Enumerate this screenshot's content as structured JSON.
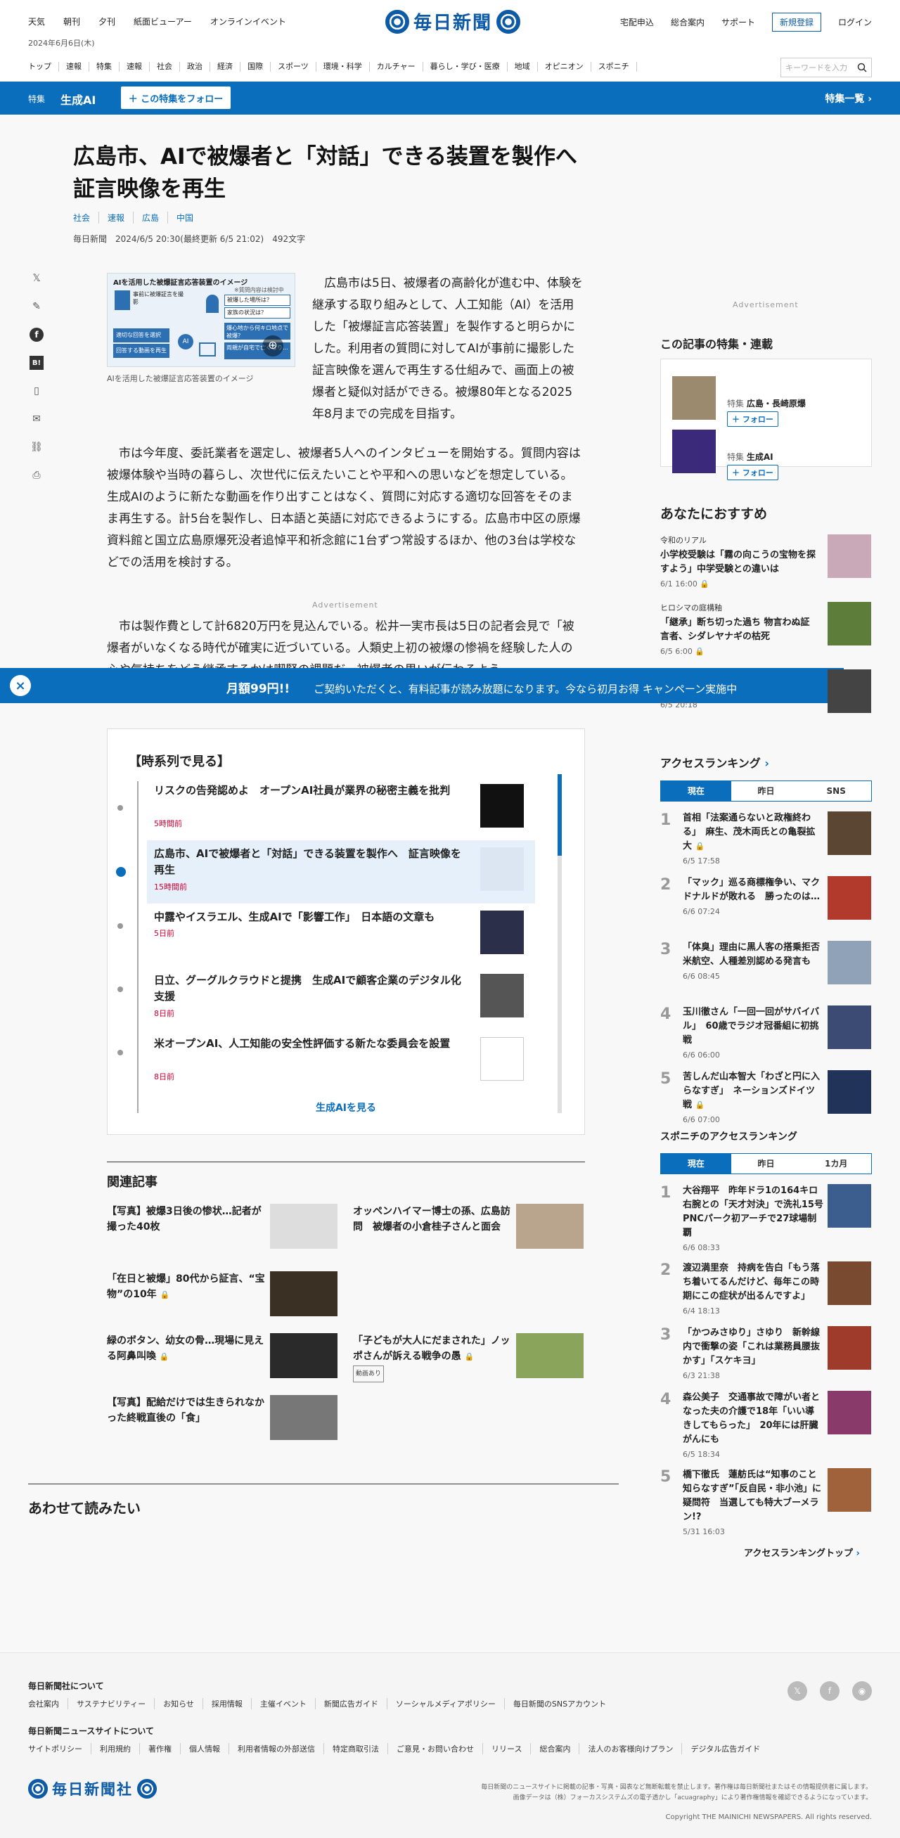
{
  "header": {
    "top_links": [
      "天気",
      "朝刊",
      "夕刊",
      "紙面ビューアー",
      "オンラインイベント"
    ],
    "date": "2024年6月6日(木)",
    "logo": "毎日新聞",
    "right_links": [
      "宅配申込",
      "総合案内",
      "サポート"
    ],
    "register": "新規登録",
    "login": "ログイン",
    "nav": [
      "トップ",
      "速報",
      "特集",
      "速報",
      "社会",
      "政治",
      "経済",
      "国際",
      "スポーツ",
      "環境・科学",
      "カルチャー",
      "暮らし・学び・医療",
      "地域",
      "オピニオン",
      "スポニチ"
    ],
    "search_placeholder": "キーワードを入力"
  },
  "feature_bar": {
    "tag": "特集",
    "title": "生成AI",
    "follow": "＋ この特集をフォロー",
    "list": "特集一覧"
  },
  "article": {
    "title": "広島市、AIで被爆者と「対話」できる装置を製作へ　証言映像を再生",
    "tags": [
      "社会",
      "速報",
      "広島",
      "中国"
    ],
    "source": "毎日新聞",
    "date": "2024/6/5 20:30(最終更新 6/5 21:02)",
    "chars": "492文字",
    "figure_title": "AIを活用した被爆証言応答装置のイメージ",
    "figure_note": "※質問内容は検討中",
    "figure_labels": [
      "事前に被爆証言を撮影",
      "被爆した場所は？",
      "家族の状況は？",
      "適切な回答を選択",
      "回答する動画を再生",
      "爆心地から何キロ地点で被爆？",
      "両親が自宅で亡くなり…"
    ],
    "figure_caption": "AIを活用した被爆証言応答装置のイメージ",
    "lead": "広島市は5日、被爆者の高齢化が進む中、体験を継承する取り組みとして、人工知能（AI）を活用した「被爆証言応答装置」を製作すると明らかにした。利用者の質問に対してAIが事前に撮影した証言映像を選んで再生する仕組みで、画面上の被爆者と疑似対話ができる。被爆80年となる2025年8月までの完成を目指す。",
    "para2": "市は今年度、委託業者を選定し、被爆者5人へのインタビューを開始する。質問内容は被爆体験や当時の暮らし、次世代に伝えたいことや平和への思いなどを想定している。生成AIのように新たな動画を作り出すことはなく、質問に対応する適切な回答をそのまま再生する。計5台を製作し、日本語と英語に対応できるようにする。広島市中区の原爆資料館と国立広島原爆死没者追悼平和祈念館に1台ずつ常設するほか、他の3台は学校などでの活用を検討する。",
    "advertisement": "Advertisement",
    "para3": "市は製作費として計6820万円を見込んでいる。松井一実市長は5日の記者会見で「被爆者がいなくなる時代が確実に近づいている。人類史上初の被爆の惨禍を経験した人の心や気持ちをどう継承するかは喫緊の課題だ。被爆者の思いが伝わるよう"
  },
  "banner": {
    "price": "月額99円!!",
    "text": "ご契約いただくと、有料記事が読み放題になります。今なら初月お得 キャンペーン実施中"
  },
  "timeline": {
    "title": "【時系列で見る】",
    "items": [
      {
        "title": "リスクの告発認めよ　オープンAI社員が業界の秘密主義を批判",
        "time": "5時間前"
      },
      {
        "title": "広島市、AIで被爆者と「対話」できる装置を製作へ　証言映像を再生",
        "time": "15時間前"
      },
      {
        "title": "中露やイスラエル、生成AIで「影響工作」　日本語の文章も",
        "time": "5日前"
      },
      {
        "title": "日立、グーグルクラウドと提携　生成AIで顧客企業のデジタル化支援",
        "time": "8日前"
      },
      {
        "title": "米オープンAI、人工知能の安全性評価する新たな委員会を設置",
        "time": "8日前"
      }
    ],
    "more": "生成AIを見る"
  },
  "related": {
    "title": "関連記事",
    "items": [
      {
        "title": "【写真】被爆3日後の惨状…記者が撮った40枚"
      },
      {
        "title": "オッペンハイマー博士の孫、広島訪問　被爆者の小倉桂子さんと面会"
      },
      {
        "title": "「在日と被爆」80代から証言、“宝物”の10年"
      },
      {
        "title": "緑のボタン、幼女の骨…現場に見える阿鼻叫喚"
      },
      {
        "title": "「子どもが大人にだまされた」ノッポさんが訴える戦争の愚",
        "badge": "動画あり"
      },
      {
        "title": "【写真】配給だけでは生きられなかった終戦直後の「食」"
      }
    ]
  },
  "also_read": "あわせて読みたい",
  "sidebar": {
    "advertisement": "Advertisement",
    "features_title": "この記事の特集・連載",
    "features": [
      {
        "tag": "特集",
        "name": "広島・長崎原爆",
        "follow": "＋ フォロー"
      },
      {
        "tag": "特集",
        "name": "生成AI",
        "follow": "＋ フォロー"
      }
    ],
    "recommend_title": "あなたにおすすめ",
    "recommend": [
      {
        "category": "令和のリアル",
        "title": "小学校受験は「霧の向こうの宝物を探すよう」中学受験との違いは",
        "date": "6/1 16:00"
      },
      {
        "category": "ヒロシマの庭構釉",
        "title": "「継承」断ち切った過ち 物言わぬ証言者、シダレヤナギの枯死",
        "date": "6/5 6:00"
      },
      {
        "date": "6/5 20:18"
      }
    ],
    "access_title": "アクセスランキング",
    "access_tabs": [
      "現在",
      "昨日",
      "SNS"
    ],
    "access": [
      {
        "rank": "1",
        "title": "首相「法案通らないと政権終わる」　麻生、茂木両氏との亀裂拡大",
        "date": "6/5 17:58"
      },
      {
        "rank": "2",
        "title": "「マック」巡る商標権争い、マクドナルドが敗れる　勝ったのは…",
        "date": "6/6 07:24"
      },
      {
        "rank": "3",
        "title": "「体臭」理由に黒人客の搭乗拒否　米航空、人種差別認める発言も",
        "date": "6/6 08:45"
      },
      {
        "rank": "4",
        "title": "玉川徹さん「一回一回がサバイバル」　60歳でラジオ冠番組に初挑戦",
        "date": "6/6 06:00"
      },
      {
        "rank": "5",
        "title": "苦しんだ山本智大「わざと円に入らなすぎ」　ネーションズドイツ戦",
        "date": "6/6 07:00"
      }
    ],
    "sponichi_title": "スポニチのアクセスランキング",
    "sponichi_tabs": [
      "現在",
      "昨日",
      "1カ月"
    ],
    "sponichi": [
      {
        "rank": "1",
        "title": "大谷翔平　昨年ドラ1の164キロ右腕との「天才対決」で洗礼15号　PNCパーク初アーチで27球場制覇",
        "date": "6/6 08:33"
      },
      {
        "rank": "2",
        "title": "渡辺満里奈　持病を告白「もう落ち着いてるんだけど、毎年この時期にこの症状が出るんですよ」",
        "date": "6/4 18:13"
      },
      {
        "rank": "3",
        "title": "「かつみさゆり」さゆり　新幹線内で衝撃の姿「これは業務員腰抜かす」「スケキヨ」",
        "date": "6/3 21:38"
      },
      {
        "rank": "4",
        "title": "森公美子　交通事故で障がい者となった夫の介護で18年「いい導きしてもらった」　20年には肝臓がんにも",
        "date": "6/5 18:34"
      },
      {
        "rank": "5",
        "title": "橋下徹氏　蓮舫氏は“知事のこと知らなすぎ”「反自民・非小池」に疑問符　当選しても特大ブーメラン!?",
        "date": "5/31 16:03"
      }
    ],
    "ranking_top": "アクセスランキングトップ"
  },
  "footer": {
    "about_title": "毎日新聞社について",
    "about_links": [
      "会社案内",
      "サステナビリティー",
      "お知らせ",
      "採用情報",
      "主催イベント",
      "新聞広告ガイド",
      "ソーシャルメディアポリシー",
      "毎日新聞のSNSアカウント"
    ],
    "site_title": "毎日新聞ニュースサイトについて",
    "site_links": [
      "サイトポリシー",
      "利用規約",
      "著作権",
      "個人情報",
      "利用者情報の外部送信",
      "特定商取引法",
      "ご意見・お問い合わせ",
      "リリース",
      "総合案内",
      "法人のお客様向けプラン",
      "デジタル広告ガイド"
    ],
    "logo": "毎日新聞社",
    "note1": "毎日新聞のニュースサイトに掲載の記事・写真・図表など無断転載を禁止します。著作権は毎日新聞社またはその情報提供者に属します。",
    "note2": "画像データは（株）フォーカスシステムズの電子透かし「acuagraphy」により著作権情報を確認できるようになっています。",
    "copyright": "Copyright THE MAINICHI NEWSPAPERS. All rights reserved."
  }
}
